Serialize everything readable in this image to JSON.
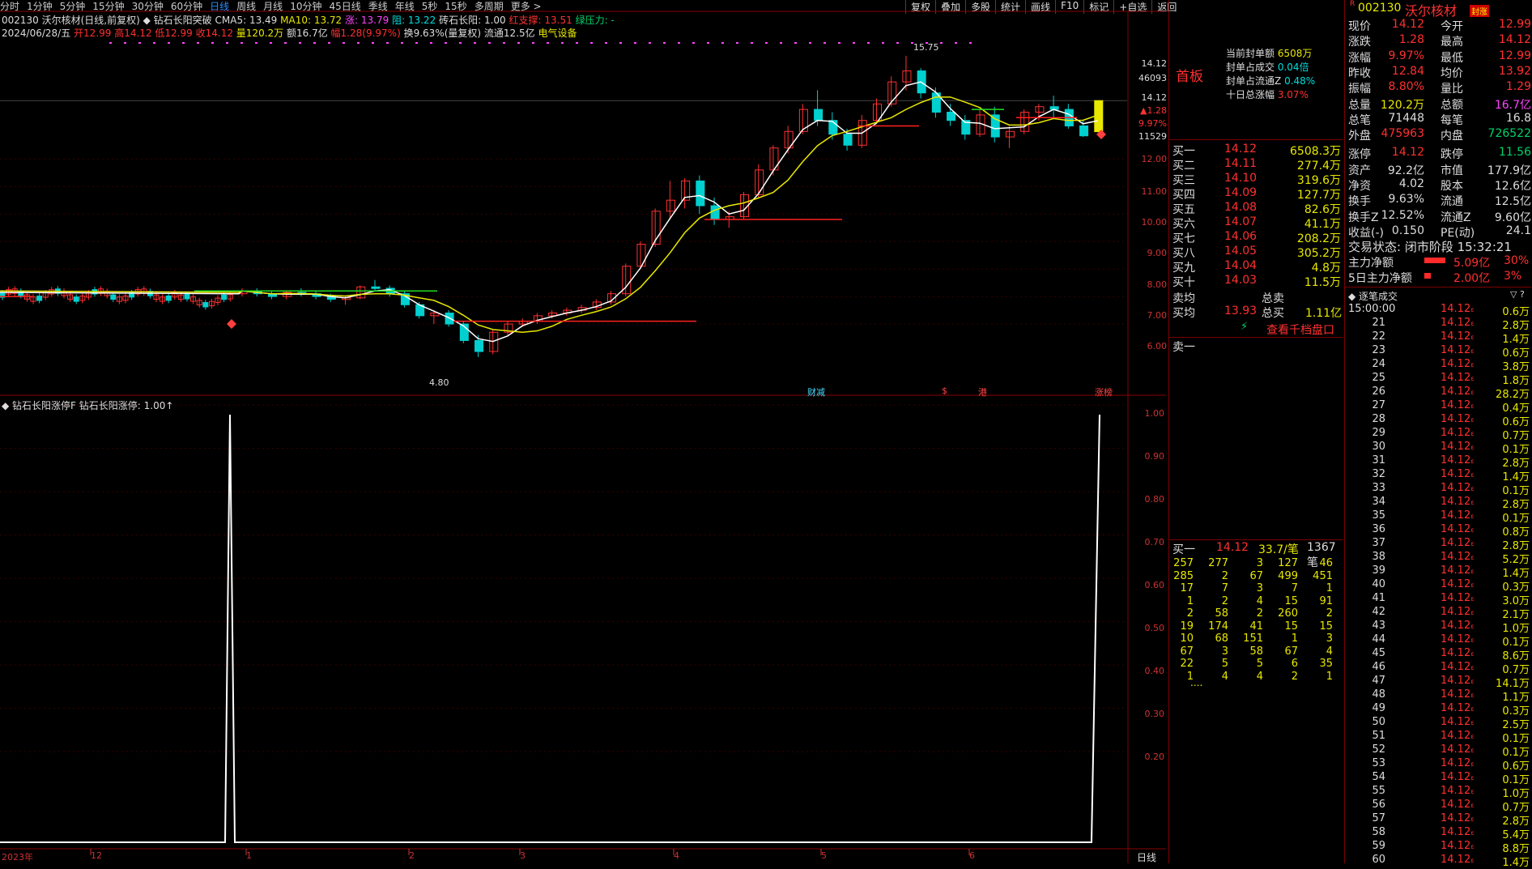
{
  "toolbar": {
    "periods": [
      "分时",
      "1分钟",
      "5分钟",
      "15分钟",
      "30分钟",
      "60分钟",
      "日线",
      "周线",
      "月线",
      "10分钟",
      "45日线",
      "季线",
      "年线",
      "5秒",
      "15秒",
      "多周期",
      "更多 >"
    ],
    "active": "日线",
    "right": [
      "复权",
      "叠加",
      "多股",
      "统计",
      "画线",
      "F10",
      "标记",
      "+自选",
      "返回"
    ]
  },
  "header": {
    "stock": "002130 沃尔核材(日线,前复权)",
    "indicator": "◆ 钻石长阳突破",
    "cma5": "CMA5: 13.49",
    "ma10": "MA10: 13.72",
    "up": "涨: 13.79",
    "zu": "阻: 13.22",
    "zs": "砖石长阳: 1.00",
    "hongzc": "红支撑: 13.51",
    "lvyl": "绿压力: -",
    "date": "2024/06/28/五",
    "open": "开12.99",
    "high": "高14.12",
    "low": "低12.99",
    "close": "收14.12",
    "vol": "量120.2万",
    "amt": "额16.7亿",
    "chg": "幅1.28(9.97%)",
    "turn": "换9.63%(量复权)",
    "float": "流通12.5亿",
    "sector": "电气设备"
  },
  "price_axis": [
    "14.12",
    "46093",
    "14.12",
    "▲1.28",
    "9.97%",
    "11529",
    "12.00",
    "11.00",
    "10.00",
    "9.00",
    "8.00",
    "7.00",
    "6.00"
  ],
  "annotations": {
    "high": "15.75",
    "low": "4.80",
    "cai": "财减",
    "s": "$",
    "gang": "港",
    "zt": "涨榜"
  },
  "lower": {
    "title": "◆ 钻石长阳涨停F",
    "value": "钻石长阳涨停: 1.00↑",
    "axis": [
      "1.00",
      "0.90",
      "0.80",
      "0.70",
      "0.60",
      "0.50",
      "0.40",
      "0.30",
      "0.20"
    ]
  },
  "xaxis": {
    "labels": [
      "2023年",
      "12",
      "1",
      "2",
      "3",
      "4",
      "5",
      "6"
    ],
    "mode": "日线"
  },
  "side": {
    "board": "首板",
    "info": [
      [
        "当前封单额",
        "6508万"
      ],
      [
        "封单占成交",
        "0.04倍"
      ],
      [
        "封单占流通Z",
        "0.48%"
      ],
      [
        "十日总涨幅",
        "3.07%"
      ]
    ],
    "buys": [
      [
        "买一",
        "14.12",
        "6508.3万"
      ],
      [
        "买二",
        "14.11",
        "277.4万"
      ],
      [
        "买三",
        "14.10",
        "319.6万"
      ],
      [
        "买四",
        "14.09",
        "127.7万"
      ],
      [
        "买五",
        "14.08",
        "82.6万"
      ],
      [
        "买六",
        "14.07",
        "41.1万"
      ],
      [
        "买七",
        "14.06",
        "208.2万"
      ],
      [
        "买八",
        "14.05",
        "305.2万"
      ],
      [
        "买九",
        "14.04",
        "4.8万"
      ],
      [
        "买十",
        "14.03",
        "11.5万"
      ]
    ],
    "avg_sell": "卖均",
    "total_sell": "总卖",
    "avg_buy": "买均",
    "avg_buy_v": "13.93",
    "total_buy": "总买",
    "total_buy_v": "1.11亿",
    "link": "查看千档盘口",
    "sell1": "卖一",
    "queue_head": [
      "买一",
      "14.12",
      "33.7/笔",
      "1367笔"
    ],
    "queue": [
      [
        "257",
        "277",
        "3",
        "127",
        "46"
      ],
      [
        "285",
        "2",
        "67",
        "499",
        "451"
      ],
      [
        "17",
        "7",
        "3",
        "7",
        "1"
      ],
      [
        "1",
        "2",
        "4",
        "15",
        "91"
      ],
      [
        "2",
        "58",
        "2",
        "260",
        "2"
      ],
      [
        "19",
        "174",
        "41",
        "15",
        "15"
      ],
      [
        "10",
        "68",
        "151",
        "1",
        "3"
      ],
      [
        "67",
        "3",
        "58",
        "67",
        "4"
      ],
      [
        "22",
        "5",
        "5",
        "6",
        "35"
      ],
      [
        "1",
        "4",
        "4",
        "2",
        "1"
      ]
    ],
    "more": "...."
  },
  "quote": {
    "code": "002130",
    "name": "沃尔核材",
    "tag": "封涨",
    "rows": [
      [
        "现价",
        "14.12",
        "今开",
        "12.99"
      ],
      [
        "涨跌",
        "1.28",
        "最高",
        "14.12"
      ],
      [
        "涨幅",
        "9.97%",
        "最低",
        "12.99"
      ],
      [
        "昨收",
        "12.84",
        "均价",
        "13.92"
      ],
      [
        "振幅",
        "8.80%",
        "量比",
        "1.29"
      ],
      [
        "总量",
        "120.2万",
        "总额",
        "16.7亿"
      ],
      [
        "总笔",
        "71448",
        "每笔",
        "16.8"
      ],
      [
        "外盘",
        "475963",
        "内盘",
        "726522"
      ],
      [
        "涨停",
        "14.12",
        "跌停",
        "11.56"
      ],
      [
        "资产",
        "92.2亿",
        "市值",
        "177.9亿"
      ],
      [
        "净资",
        "4.02",
        "股本",
        "12.6亿"
      ],
      [
        "换手",
        "9.63%",
        "流通",
        "12.5亿"
      ],
      [
        "换手Z",
        "12.52%",
        "流通Z",
        "9.60亿"
      ],
      [
        "收益(-)",
        "0.150",
        "PE(动)",
        "24.1"
      ]
    ],
    "status": "交易状态: 闭市阶段 15:32:21",
    "main_net": [
      "主力净额",
      "5.09亿",
      "30%"
    ],
    "main_net5": [
      "5日主力净额",
      "2.00亿",
      "3%"
    ],
    "trades_title": "逐笔成交",
    "trades": [
      [
        "15:00:00",
        "14.12",
        "0.6万"
      ],
      [
        "21",
        "14.12",
        "2.8万"
      ],
      [
        "22",
        "14.12",
        "1.4万"
      ],
      [
        "23",
        "14.12",
        "0.6万"
      ],
      [
        "24",
        "14.12",
        "3.8万"
      ],
      [
        "25",
        "14.12",
        "1.8万"
      ],
      [
        "26",
        "14.12",
        "28.2万"
      ],
      [
        "27",
        "14.12",
        "0.4万"
      ],
      [
        "28",
        "14.12",
        "0.6万"
      ],
      [
        "29",
        "14.12",
        "0.7万"
      ],
      [
        "30",
        "14.12",
        "0.1万"
      ],
      [
        "31",
        "14.12",
        "2.8万"
      ],
      [
        "32",
        "14.12",
        "1.4万"
      ],
      [
        "33",
        "14.12",
        "0.1万"
      ],
      [
        "34",
        "14.12",
        "2.8万"
      ],
      [
        "35",
        "14.12",
        "0.1万"
      ],
      [
        "36",
        "14.12",
        "0.8万"
      ],
      [
        "37",
        "14.12",
        "2.8万"
      ],
      [
        "38",
        "14.12",
        "5.2万"
      ],
      [
        "39",
        "14.12",
        "1.4万"
      ],
      [
        "40",
        "14.12",
        "0.3万"
      ],
      [
        "41",
        "14.12",
        "3.0万"
      ],
      [
        "42",
        "14.12",
        "2.1万"
      ],
      [
        "43",
        "14.12",
        "1.0万"
      ],
      [
        "44",
        "14.12",
        "0.1万"
      ],
      [
        "45",
        "14.12",
        "8.6万"
      ],
      [
        "46",
        "14.12",
        "0.7万"
      ],
      [
        "47",
        "14.12",
        "14.1万"
      ],
      [
        "48",
        "14.12",
        "1.1万"
      ],
      [
        "49",
        "14.12",
        "0.3万"
      ],
      [
        "50",
        "14.12",
        "2.5万"
      ],
      [
        "51",
        "14.12",
        "0.1万"
      ],
      [
        "52",
        "14.12",
        "0.1万"
      ],
      [
        "53",
        "14.12",
        "0.6万"
      ],
      [
        "54",
        "14.12",
        "0.1万"
      ],
      [
        "55",
        "14.12",
        "1.0万"
      ],
      [
        "56",
        "14.12",
        "0.7万"
      ],
      [
        "57",
        "14.12",
        "2.8万"
      ],
      [
        "58",
        "14.12",
        "5.4万"
      ],
      [
        "59",
        "14.12",
        "8.8万"
      ],
      [
        "60",
        "14.12",
        "1.4万"
      ]
    ]
  },
  "chart_data": {
    "type": "candlestick",
    "note": "approximate daily OHLC values read from chart, Nov 2023 - Jun 2024",
    "ohlc": [
      [
        7.1,
        7.3,
        7.0,
        7.2
      ],
      [
        7.2,
        7.3,
        7.0,
        7.1
      ],
      [
        7.1,
        7.2,
        6.9,
        7.0
      ],
      [
        7.0,
        7.2,
        6.9,
        7.15
      ],
      [
        7.15,
        7.3,
        7.0,
        7.1
      ],
      [
        7.1,
        7.2,
        6.9,
        7.0
      ],
      [
        7.0,
        7.1,
        6.8,
        6.9
      ],
      [
        6.9,
        7.0,
        6.7,
        6.95
      ],
      [
        6.95,
        7.4,
        6.9,
        7.35
      ],
      [
        7.35,
        7.6,
        7.2,
        7.3
      ],
      [
        7.3,
        7.4,
        7.0,
        7.1
      ],
      [
        7.1,
        7.2,
        6.6,
        6.7
      ],
      [
        6.7,
        6.8,
        6.2,
        6.3
      ],
      [
        6.3,
        6.5,
        6.0,
        6.4
      ],
      [
        6.4,
        6.5,
        5.9,
        6.0
      ],
      [
        6.0,
        6.1,
        5.3,
        5.4
      ],
      [
        5.4,
        5.6,
        4.8,
        5.0
      ],
      [
        5.0,
        5.8,
        4.9,
        5.7
      ],
      [
        5.7,
        6.1,
        5.6,
        6.0
      ],
      [
        6.0,
        6.2,
        5.9,
        6.1
      ],
      [
        6.1,
        6.4,
        6.0,
        6.3
      ],
      [
        6.3,
        6.5,
        6.2,
        6.4
      ],
      [
        6.4,
        6.6,
        6.3,
        6.5
      ],
      [
        6.5,
        6.7,
        6.4,
        6.6
      ],
      [
        6.6,
        6.9,
        6.5,
        6.8
      ],
      [
        6.8,
        7.2,
        6.7,
        7.1
      ],
      [
        7.1,
        8.2,
        7.0,
        8.1
      ],
      [
        8.1,
        9.0,
        8.0,
        8.9
      ],
      [
        8.9,
        10.2,
        8.8,
        10.1
      ],
      [
        10.1,
        11.2,
        9.8,
        10.5
      ],
      [
        10.5,
        11.3,
        10.2,
        11.2
      ],
      [
        11.2,
        11.4,
        10.0,
        10.3
      ],
      [
        10.3,
        10.6,
        9.6,
        9.8
      ],
      [
        9.8,
        10.1,
        9.5,
        9.9
      ],
      [
        9.9,
        10.8,
        9.8,
        10.7
      ],
      [
        10.7,
        11.8,
        10.6,
        11.6
      ],
      [
        11.6,
        12.5,
        11.4,
        12.4
      ],
      [
        12.4,
        13.2,
        12.2,
        13.0
      ],
      [
        13.0,
        14.0,
        12.9,
        13.8
      ],
      [
        13.8,
        14.5,
        13.2,
        13.4
      ],
      [
        13.4,
        13.7,
        12.7,
        12.9
      ],
      [
        12.9,
        13.1,
        12.3,
        12.5
      ],
      [
        12.5,
        13.6,
        12.4,
        13.4
      ],
      [
        13.4,
        14.2,
        13.3,
        14.0
      ],
      [
        14.0,
        15.0,
        13.9,
        14.8
      ],
      [
        14.8,
        15.75,
        14.5,
        15.2
      ],
      [
        15.2,
        15.3,
        14.2,
        14.4
      ],
      [
        14.4,
        14.6,
        13.5,
        13.7
      ],
      [
        13.7,
        14.0,
        13.2,
        13.4
      ],
      [
        13.4,
        13.6,
        12.7,
        12.9
      ],
      [
        12.9,
        13.8,
        12.8,
        13.6
      ],
      [
        13.6,
        13.9,
        12.6,
        12.8
      ],
      [
        12.8,
        13.2,
        12.4,
        13.0
      ],
      [
        13.0,
        13.8,
        12.9,
        13.7
      ],
      [
        13.7,
        14.0,
        13.4,
        13.9
      ],
      [
        13.9,
        14.3,
        13.5,
        13.8
      ],
      [
        13.8,
        14.0,
        13.1,
        13.2
      ],
      [
        13.2,
        13.4,
        12.8,
        12.84
      ],
      [
        12.99,
        14.12,
        12.99,
        14.12
      ]
    ],
    "lower_indicator": {
      "name": "钻石长阳涨停",
      "spikes_at": [
        "2024-01",
        "2024-06-28"
      ],
      "values_range": [
        0,
        1
      ]
    }
  }
}
